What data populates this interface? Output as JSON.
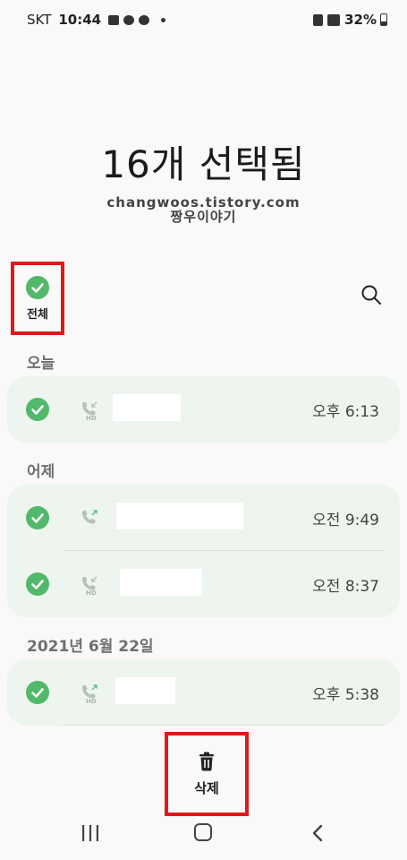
{
  "status_bar": {
    "carrier": "SKT",
    "time": "10:44",
    "battery": "32%"
  },
  "header": {
    "title": "16개 선택됨"
  },
  "watermark": {
    "line1": "changwoos.tistory.com",
    "line2": "짱우이야기"
  },
  "select_all": {
    "label": "전체"
  },
  "sections": [
    {
      "label": "오늘",
      "rows": [
        {
          "time": "오후 6:13",
          "call_type": "incoming-hd-call-icon"
        }
      ]
    },
    {
      "label": "어제",
      "rows": [
        {
          "time": "오전 9:49",
          "call_type": "outgoing-call-icon"
        },
        {
          "time": "오전 8:37",
          "call_type": "incoming-hd-call-icon"
        }
      ]
    },
    {
      "label": "2021년 6월 22일",
      "rows": [
        {
          "time": "오후 5:38",
          "call_type": "outgoing-hd-call-icon"
        }
      ]
    }
  ],
  "actions": {
    "delete_label": "삭제"
  },
  "colors": {
    "accent_green": "#52b86a",
    "highlight_red": "#e01818",
    "card_bg": "#edf5ee"
  }
}
